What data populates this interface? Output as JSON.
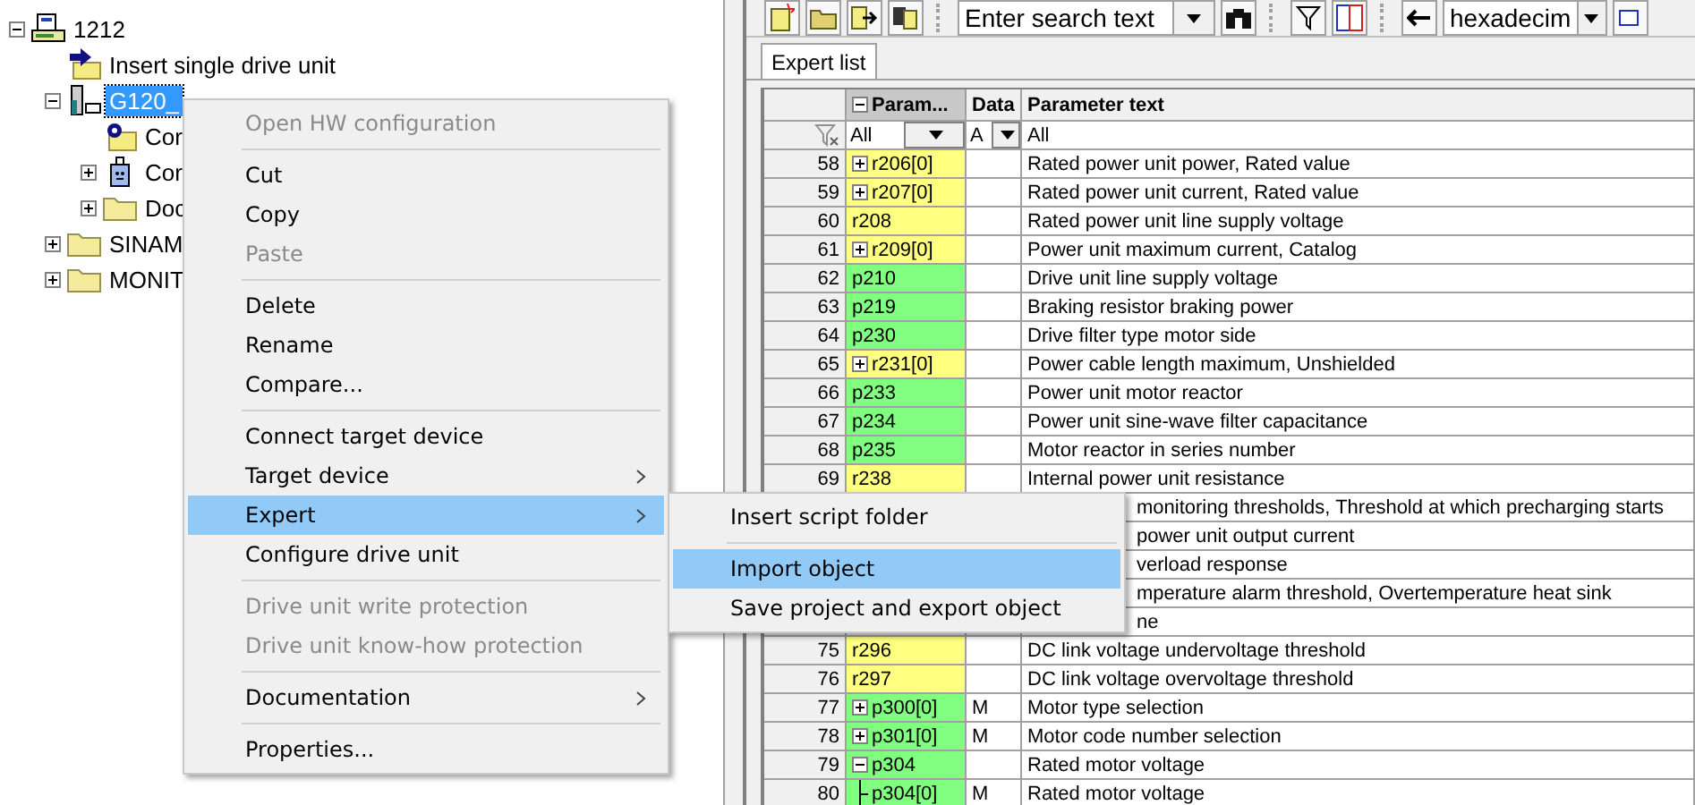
{
  "tree": [
    {
      "label": "1212",
      "kind": "project",
      "expanded": true,
      "selected": false,
      "children": [
        {
          "label": "Insert single drive unit",
          "kind": "insert",
          "selected": false
        },
        {
          "label": "G120_",
          "kind": "drive",
          "expanded": true,
          "selected": true,
          "children": [
            {
              "label": "Cor",
              "kind": "config",
              "selected": false
            },
            {
              "label": "Cor",
              "kind": "control",
              "expanded": false,
              "selected": false
            },
            {
              "label": "Doc",
              "kind": "folder",
              "expanded": false,
              "selected": false
            }
          ]
        },
        {
          "label": "SINAM",
          "kind": "folder",
          "expanded": false,
          "selected": false
        },
        {
          "label": "MONIT",
          "kind": "folder",
          "expanded": false,
          "selected": false
        }
      ]
    }
  ],
  "toolbar": {
    "search": {
      "value": "Enter search text"
    },
    "format": {
      "value": "hexadecim"
    }
  },
  "tabs": [
    {
      "label": "Expert list",
      "selected": true
    }
  ],
  "table": {
    "columns": [
      "Param...",
      "Data",
      "Parameter text"
    ],
    "filters": [
      "All",
      "A",
      "All"
    ],
    "rows": [
      {
        "number": "58",
        "kind": "plus",
        "param": "r206[0]",
        "editable": false,
        "data": "",
        "text": "Rated power unit power, Rated value"
      },
      {
        "number": "59",
        "kind": "plus",
        "param": "r207[0]",
        "editable": false,
        "data": "",
        "text": "Rated power unit current, Rated value"
      },
      {
        "number": "60",
        "kind": "none",
        "param": "r208",
        "editable": false,
        "data": "",
        "text": "Rated power unit line supply voltage"
      },
      {
        "number": "61",
        "kind": "plus",
        "param": "r209[0]",
        "editable": false,
        "data": "",
        "text": "Power unit maximum current, Catalog"
      },
      {
        "number": "62",
        "kind": "none",
        "param": "p210",
        "editable": true,
        "data": "",
        "text": "Drive unit line supply voltage"
      },
      {
        "number": "63",
        "kind": "none",
        "param": "p219",
        "editable": true,
        "data": "",
        "text": "Braking resistor braking power"
      },
      {
        "number": "64",
        "kind": "none",
        "param": "p230",
        "editable": true,
        "data": "",
        "text": "Drive filter type motor side"
      },
      {
        "number": "65",
        "kind": "plus",
        "param": "r231[0]",
        "editable": false,
        "data": "",
        "text": "Power cable length maximum, Unshielded"
      },
      {
        "number": "66",
        "kind": "none",
        "param": "p233",
        "editable": true,
        "data": "",
        "text": "Power unit motor reactor"
      },
      {
        "number": "67",
        "kind": "none",
        "param": "p234",
        "editable": true,
        "data": "",
        "text": "Power unit sine-wave filter capacitance"
      },
      {
        "number": "68",
        "kind": "none",
        "param": "p235",
        "editable": true,
        "data": "",
        "text": "Motor reactor in series number"
      },
      {
        "number": "69",
        "kind": "none",
        "param": "r238",
        "editable": false,
        "data": "",
        "text": "Internal power unit resistance"
      },
      {
        "text": "monitoring thresholds, Threshold at which precharging starts"
      },
      {
        "text": "power unit output current"
      },
      {
        "text": "verload response"
      },
      {
        "text": "mperature alarm threshold, Overtemperature heat sink"
      },
      {
        "text": "ne"
      },
      {
        "number": "75",
        "kind": "none",
        "param": "r296",
        "editable": false,
        "data": "",
        "text": "DC link voltage undervoltage threshold"
      },
      {
        "number": "76",
        "kind": "none",
        "param": "r297",
        "editable": false,
        "data": "",
        "text": "DC link voltage overvoltage threshold"
      },
      {
        "number": "77",
        "kind": "plus",
        "param": "p300[0]",
        "editable": true,
        "data": "M",
        "text": "Motor type selection"
      },
      {
        "number": "78",
        "kind": "plus",
        "param": "p301[0]",
        "editable": true,
        "data": "M",
        "text": "Motor code number selection"
      },
      {
        "number": "79",
        "kind": "minus",
        "param": "p304",
        "editable": true,
        "data": "",
        "text": "Rated motor voltage"
      },
      {
        "number": "80",
        "kind": "child",
        "param": "p304[0]",
        "editable": true,
        "data": "M",
        "text": "Rated motor voltage"
      }
    ]
  },
  "context_menu": [
    {
      "kind": "item",
      "label": "Open HW configuration",
      "disabled": true,
      "selected": false,
      "submenu": false
    },
    {
      "kind": "separator"
    },
    {
      "kind": "item",
      "label": "Cut",
      "disabled": false,
      "selected": false,
      "submenu": false
    },
    {
      "kind": "item",
      "label": "Copy",
      "disabled": false,
      "selected": false,
      "submenu": false
    },
    {
      "kind": "item",
      "label": "Paste",
      "disabled": true,
      "selected": false,
      "submenu": false
    },
    {
      "kind": "separator"
    },
    {
      "kind": "item",
      "label": "Delete",
      "disabled": false,
      "selected": false,
      "submenu": false
    },
    {
      "kind": "item",
      "label": "Rename",
      "disabled": false,
      "selected": false,
      "submenu": false
    },
    {
      "kind": "item",
      "label": "Compare...",
      "disabled": false,
      "selected": false,
      "submenu": false
    },
    {
      "kind": "separator"
    },
    {
      "kind": "item",
      "label": "Connect target device",
      "disabled": false,
      "selected": false,
      "submenu": false
    },
    {
      "kind": "item",
      "label": "Target device",
      "disabled": false,
      "selected": false,
      "submenu": true
    },
    {
      "kind": "item",
      "label": "Expert",
      "disabled": false,
      "selected": true,
      "submenu": true
    },
    {
      "kind": "item",
      "label": "Configure drive unit",
      "disabled": false,
      "selected": false,
      "submenu": false
    },
    {
      "kind": "separator"
    },
    {
      "kind": "item",
      "label": "Drive unit write protection",
      "disabled": true,
      "selected": false,
      "submenu": false
    },
    {
      "kind": "item",
      "label": "Drive unit know-how protection",
      "disabled": true,
      "selected": false,
      "submenu": false
    },
    {
      "kind": "separator"
    },
    {
      "kind": "item",
      "label": "Documentation",
      "disabled": false,
      "selected": false,
      "submenu": true
    },
    {
      "kind": "separator"
    },
    {
      "kind": "item",
      "label": "Properties...",
      "disabled": false,
      "selected": false,
      "submenu": false
    }
  ],
  "submenu": [
    {
      "kind": "item",
      "label": "Insert script folder",
      "disabled": false,
      "selected": false,
      "submenu": false
    },
    {
      "kind": "separator"
    },
    {
      "kind": "item",
      "label": "Import object",
      "disabled": false,
      "selected": true,
      "submenu": false
    },
    {
      "kind": "item",
      "label": "Save project and export object",
      "disabled": false,
      "selected": false,
      "submenu": false
    }
  ]
}
